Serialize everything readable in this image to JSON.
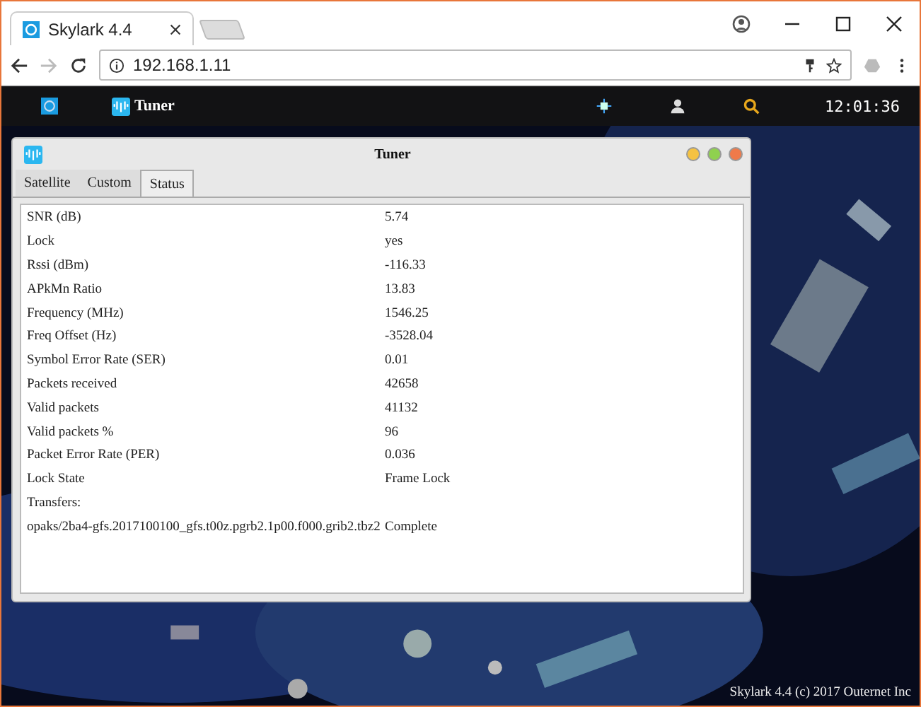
{
  "browser": {
    "tab_title": "Skylark 4.4",
    "url": "192.168.1.11"
  },
  "topbar": {
    "app_label": "Tuner",
    "clock": "12:01:36"
  },
  "window": {
    "title": "Tuner",
    "tabs": [
      {
        "label": "Satellite",
        "selected": false
      },
      {
        "label": "Custom",
        "selected": false
      },
      {
        "label": "Status",
        "selected": true
      }
    ],
    "rows": [
      {
        "label": "SNR (dB)",
        "value": "5.74"
      },
      {
        "label": "Lock",
        "value": "yes"
      },
      {
        "label": "Rssi (dBm)",
        "value": "-116.33"
      },
      {
        "label": "APkMn Ratio",
        "value": "13.83"
      },
      {
        "label": "Frequency (MHz)",
        "value": "1546.25"
      },
      {
        "label": "Freq Offset (Hz)",
        "value": "-3528.04"
      },
      {
        "label": "Symbol Error Rate (SER)",
        "value": "0.01"
      },
      {
        "label": "Packets received",
        "value": "42658"
      },
      {
        "label": "Valid packets",
        "value": "41132"
      },
      {
        "label": "Valid packets %",
        "value": "96"
      },
      {
        "label": "Packet Error Rate (PER)",
        "value": "0.036"
      },
      {
        "label": "Lock State",
        "value": "Frame Lock"
      },
      {
        "label": "Transfers:"
      },
      {
        "label": "opaks/2ba4-gfs.2017100100_gfs.t00z.pgrb2.1p00.f000.grib2.tbz2",
        "value": "Complete"
      }
    ]
  },
  "footer": "Skylark 4.4 (c) 2017 Outernet Inc"
}
